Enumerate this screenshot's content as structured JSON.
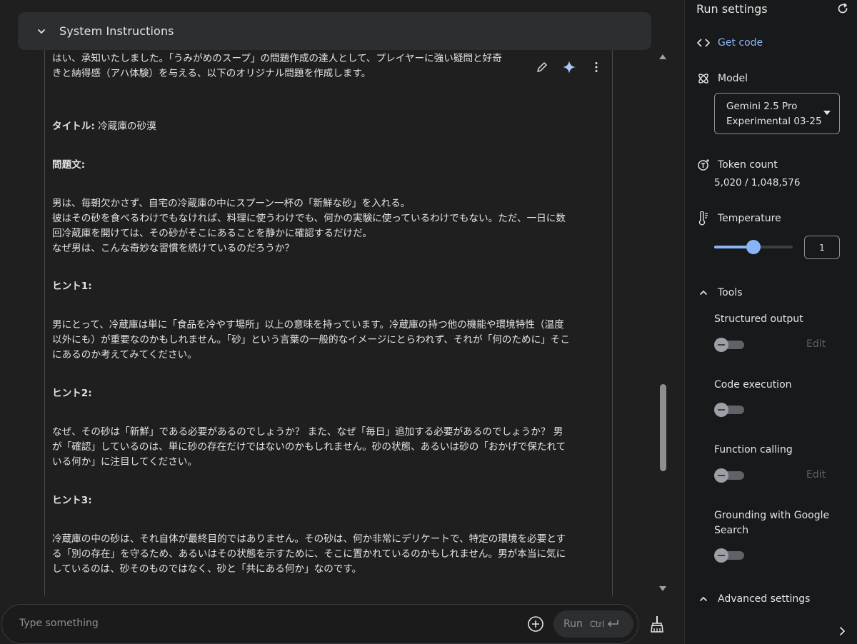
{
  "system_instructions": {
    "label": "System Instructions"
  },
  "response": {
    "intro_line1": "はい、承知いたしました。「うみがめのスープ」の問題作成の達人として、プレイヤーに強い疑問と好奇",
    "intro_line2": "きと納得感（アハ体験）を与える、以下のオリジナル問題を作成します。",
    "title_label": "タイトル:",
    "title_value": "冷蔵庫の砂漠",
    "problem_label": "問題文:",
    "problem_lines": [
      "男は、毎朝欠かさず、自宅の冷蔵庫の中にスプーン一杯の「新鮮な砂」を入れる。",
      "彼はその砂を食べるわけでもなければ、料理に使うわけでも、何かの実験に使っているわけでもない。ただ、一日に数",
      "回冷蔵庫を開けては、その砂がそこにあることを静かに確認するだけだ。",
      "なぜ男は、こんな奇妙な習慣を続けているのだろうか？"
    ],
    "hint1_label": "ヒント1:",
    "hint1_lines": [
      "男にとって、冷蔵庫は単に「食品を冷やす場所」以上の意味を持っています。冷蔵庫の持つ他の機能や環境特性（温度",
      "以外にも）が重要なのかもしれません。「砂」という言葉の一般的なイメージにとらわれず、それが「何のために」そこ",
      "にあるのか考えてみてください。"
    ],
    "hint2_label": "ヒント2:",
    "hint2_lines": [
      "なぜ、その砂は「新鮮」である必要があるのでしょうか？ また、なぜ「毎日」追加する必要があるのでしょうか？ 男",
      "が「確認」しているのは、単に砂の存在だけではないのかもしれません。砂の状態、あるいは砂の「おかげで保たれて",
      "いる何か」に注目してください。"
    ],
    "hint3_label": "ヒント3:",
    "hint3_lines": [
      "冷蔵庫の中の砂は、それ自体が最終目的ではありません。その砂は、何か非常にデリケートで、特定の環境を必要とす",
      "る「別の存在」を守るため、あるいはその状態を示すために、そこに置かれているのかもしれません。男が本当に気に",
      "しているのは、砂そのものではなく、砂と「共にある何か」なのです。"
    ]
  },
  "input": {
    "placeholder": "Type something"
  },
  "run": {
    "label": "Run",
    "shortcut": "Ctrl"
  },
  "settings": {
    "title": "Run settings",
    "get_code": "Get code",
    "model_label": "Model",
    "model_value_line1": "Gemini 2.5 Pro",
    "model_value_line2": "Experimental 03-25",
    "token_label": "Token count",
    "token_value": "5,020 / 1,048,576",
    "temperature_label": "Temperature",
    "temperature_value": "1",
    "temperature_fraction": 0.5,
    "tools_label": "Tools",
    "tools": [
      {
        "label": "Structured output",
        "edit": "Edit",
        "enabled": false
      },
      {
        "label": "Code execution",
        "edit": "",
        "enabled": false
      },
      {
        "label": "Function calling",
        "edit": "Edit",
        "enabled": false
      },
      {
        "label": "Grounding with Google Search",
        "edit": "",
        "enabled": false
      }
    ],
    "advanced_label": "Advanced settings"
  },
  "colors": {
    "accent": "#8ab4f8",
    "background": "#1f1f1f",
    "panel": "#18191a"
  }
}
